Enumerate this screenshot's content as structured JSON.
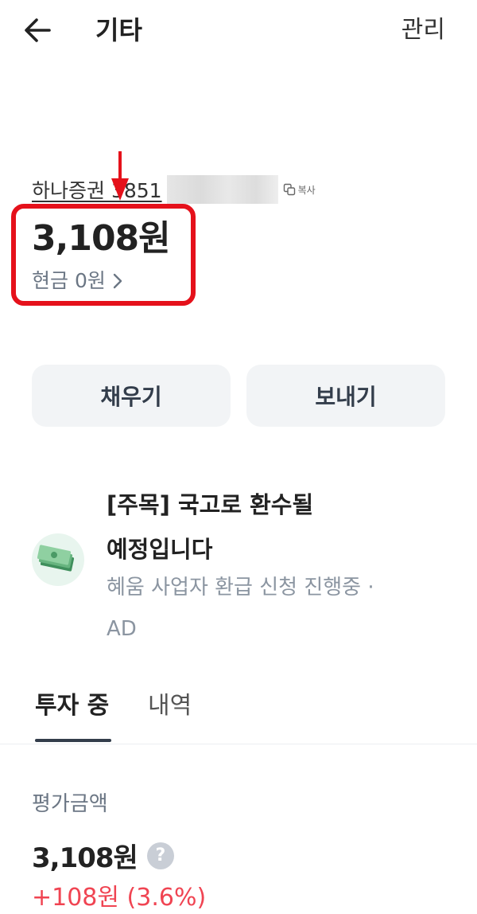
{
  "header": {
    "title": "기타",
    "manage_label": "관리"
  },
  "account": {
    "name_visible": "하나증권 3851",
    "copy_label": "복사",
    "balance": "3,108원",
    "cash": "현금 0원"
  },
  "actions": {
    "fill_label": "채우기",
    "send_label": "보내기"
  },
  "ad": {
    "title_line1": "[주목] 국고로 환수될",
    "title_line2": "예정입니다",
    "subtitle_line1": "혜움 사업자 환급 신청 진행중 ·",
    "subtitle_line2": "AD",
    "icon": "money-stack-icon"
  },
  "tabs": [
    {
      "label": "투자 중",
      "active": true
    },
    {
      "label": "내역",
      "active": false
    }
  ],
  "summary": {
    "label": "평가금액",
    "value": "3,108원",
    "help_symbol": "?",
    "change": "+108원 (3.6%)"
  },
  "colors": {
    "text_primary": "#191f28",
    "text_secondary": "#6b7684",
    "button_bg": "#f2f4f6",
    "annotation_red": "#e5111b",
    "gain_red": "#f04452",
    "ad_icon_bg": "#e8f5ee"
  }
}
